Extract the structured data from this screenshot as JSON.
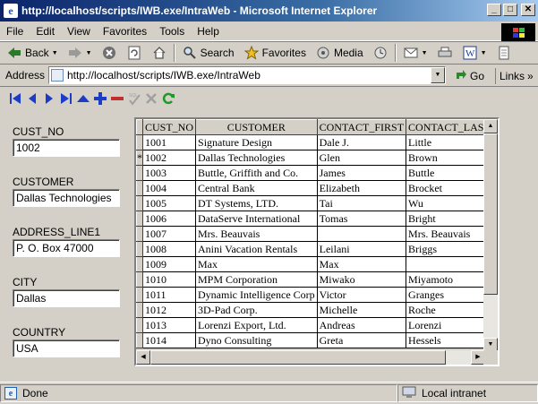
{
  "window": {
    "title": "http://localhost/scripts/IWB.exe/IntraWeb - Microsoft Internet Explorer",
    "minimize": "_",
    "maximize": "□",
    "close": "✕"
  },
  "menu": {
    "items": [
      "File",
      "Edit",
      "View",
      "Favorites",
      "Tools",
      "Help"
    ]
  },
  "toolbar": {
    "back_label": "Back",
    "search_label": "Search",
    "favorites_label": "Favorites",
    "media_label": "Media"
  },
  "address": {
    "label": "Address",
    "url": "http://localhost/scripts/IWB.exe/IntraWeb",
    "go_label": "Go",
    "links_label": "Links"
  },
  "form": {
    "cust_no_label": "CUST_NO",
    "cust_no_value": "1002",
    "customer_label": "CUSTOMER",
    "customer_value": "Dallas Technologies",
    "address_label": "ADDRESS_LINE1",
    "address_value": "P. O. Box 47000",
    "city_label": "CITY",
    "city_value": "Dallas",
    "country_label": "COUNTRY",
    "country_value": "USA"
  },
  "grid": {
    "columns": [
      "CUST_NO",
      "CUSTOMER",
      "CONTACT_FIRST",
      "CONTACT_LAST"
    ],
    "current_indicator": "*",
    "rows": [
      [
        "1001",
        "Signature Design",
        "Dale J.",
        "Little"
      ],
      [
        "1002",
        "Dallas Technologies",
        "Glen",
        "Brown"
      ],
      [
        "1003",
        "Buttle, Griffith and Co.",
        "James",
        "Buttle"
      ],
      [
        "1004",
        "Central Bank",
        "Elizabeth",
        "Brocket"
      ],
      [
        "1005",
        "DT Systems, LTD.",
        "Tai",
        "Wu"
      ],
      [
        "1006",
        "DataServe International",
        "Tomas",
        "Bright"
      ],
      [
        "1007",
        "Mrs. Beauvais",
        "",
        "Mrs. Beauvais"
      ],
      [
        "1008",
        "Anini Vacation Rentals",
        "Leilani",
        "Briggs"
      ],
      [
        "1009",
        "Max",
        "Max",
        ""
      ],
      [
        "1010",
        "MPM Corporation",
        "Miwako",
        "Miyamoto"
      ],
      [
        "1011",
        "Dynamic Intelligence Corp",
        "Victor",
        "Granges"
      ],
      [
        "1012",
        "3D-Pad Corp.",
        "Michelle",
        "Roche"
      ],
      [
        "1013",
        "Lorenzi Export, Ltd.",
        "Andreas",
        "Lorenzi"
      ],
      [
        "1014",
        "Dyno Consulting",
        "Greta",
        "Hessels"
      ]
    ]
  },
  "status": {
    "text": "Done",
    "zone": "Local intranet"
  },
  "colors": {
    "nav_blue": "#1c3cc8",
    "nav_red": "#c03030",
    "refresh_green": "#1c9a28"
  }
}
